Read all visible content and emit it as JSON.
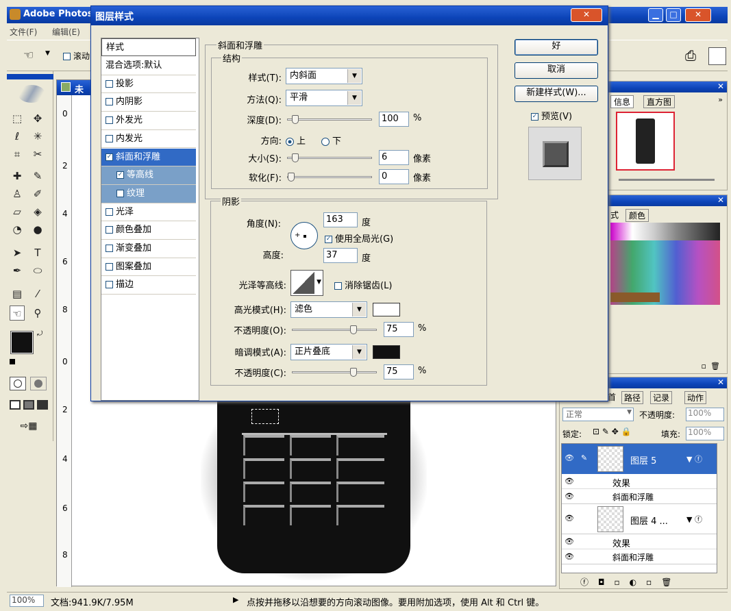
{
  "app": {
    "title": "Adobe Photos",
    "menu": [
      "文件(F)",
      "编辑(E)"
    ],
    "tool_option": "滚动"
  },
  "doc": {
    "title": "未",
    "ruler_v": [
      "0",
      "2",
      "4",
      "6",
      "8",
      "0",
      "2",
      "4",
      "6",
      "8"
    ]
  },
  "dialog": {
    "title": "图层样式",
    "styles_header": "样式",
    "styles": [
      {
        "label": "混合选项:默认",
        "checkbox": false,
        "checked": false
      },
      {
        "label": "投影",
        "checkbox": true,
        "checked": false
      },
      {
        "label": "内阴影",
        "checkbox": true,
        "checked": false
      },
      {
        "label": "外发光",
        "checkbox": true,
        "checked": false
      },
      {
        "label": "内发光",
        "checkbox": true,
        "checked": false
      },
      {
        "label": "斜面和浮雕",
        "checkbox": true,
        "checked": true,
        "selected": true
      },
      {
        "label": "等高线",
        "checkbox": true,
        "checked": true,
        "sub": true
      },
      {
        "label": "纹理",
        "checkbox": true,
        "checked": false,
        "sub": true
      },
      {
        "label": "光泽",
        "checkbox": true,
        "checked": false
      },
      {
        "label": "颜色叠加",
        "checkbox": true,
        "checked": false
      },
      {
        "label": "渐变叠加",
        "checkbox": true,
        "checked": false
      },
      {
        "label": "图案叠加",
        "checkbox": true,
        "checked": false
      },
      {
        "label": "描边",
        "checkbox": true,
        "checked": false
      }
    ],
    "bevel": {
      "group_title": "斜面和浮雕",
      "structure_title": "结构",
      "style_label": "样式(T):",
      "style_value": "内斜面",
      "method_label": "方法(Q):",
      "method_value": "平滑",
      "depth_label": "深度(D):",
      "depth_value": "100",
      "depth_unit": "%",
      "depth_level": 0.05,
      "direction_label": "方向:",
      "dir_up": "上",
      "dir_down": "下",
      "size_label": "大小(S):",
      "size_value": "6",
      "size_unit": "像素",
      "size_level": 0.05,
      "soften_label": "软化(F):",
      "soften_value": "0",
      "soften_unit": "像素",
      "soften_level": 0.0
    },
    "shading": {
      "title": "阴影",
      "angle_label": "角度(N):",
      "angle_value": "163",
      "angle_unit": "度",
      "global_light": "使用全局光(G)",
      "altitude_label": "高度:",
      "altitude_value": "37",
      "altitude_unit": "度",
      "gloss_label": "光泽等高线:",
      "antialias": "消除锯齿(L)",
      "highlight_label": "高光模式(H):",
      "highlight_value": "滤色",
      "highlight_color": "#ffffff",
      "hl_opacity_label": "不透明度(O):",
      "hl_opacity_value": "75",
      "hl_opacity_unit": "%",
      "hl_opacity_level": 0.75,
      "shadow_label": "暗调模式(A):",
      "shadow_value": "正片叠底",
      "shadow_color": "#111111",
      "sh_opacity_label": "不透明度(C):",
      "sh_opacity_value": "75",
      "sh_opacity_unit": "%",
      "sh_opacity_level": 0.75
    },
    "buttons": {
      "ok": "好",
      "cancel": "取消",
      "new_style": "新建样式(W)...",
      "preview": "预览(V)"
    }
  },
  "panels": {
    "nav_tabs": [
      "信息",
      "直方图"
    ],
    "color_tabs": [
      "式",
      "颜色"
    ],
    "layers_tabs": [
      "首",
      "路径",
      "记录",
      "动作"
    ],
    "blend_mode": "正常",
    "opacity_label": "不透明度:",
    "opacity_value": "100%",
    "lock_label": "锁定:",
    "fill_label": "填充:",
    "fill_value": "100%",
    "layers": [
      {
        "name": "图层 5",
        "selected": true
      },
      {
        "name": "效果",
        "effect_header": true
      },
      {
        "name": "斜面和浮雕",
        "effect": true
      },
      {
        "name": "图层 4 ...",
        "selected": false
      },
      {
        "name": "效果",
        "effect_header": true
      },
      {
        "name": "斜面和浮雕",
        "effect": true
      }
    ]
  },
  "status": {
    "zoom": "100%",
    "doc": "文档:941.9K/7.95M",
    "hint": "点按并拖移以沿想要的方向滚动图像。要用附加选项，使用 Alt 和 Ctrl 键。"
  }
}
